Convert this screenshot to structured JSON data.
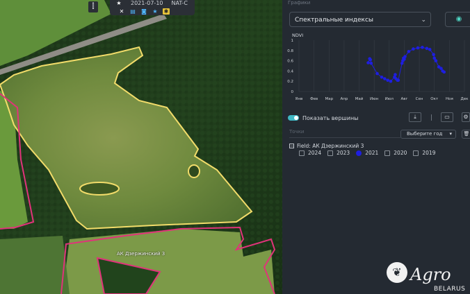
{
  "map": {
    "toolbar": {
      "date": "2021-07-10",
      "source": "NAT-C"
    },
    "field_label": "АК Дзержинский 3"
  },
  "panel": {
    "section_title": "Графики",
    "index_select": {
      "value": "Спектральные индексы"
    },
    "chart_data": {
      "type": "scatter",
      "title": "",
      "ylabel": "NDVI",
      "xlabel": "",
      "x_ticks": [
        "Янв",
        "Фев",
        "Мар",
        "Апр",
        "Май",
        "Июн",
        "Июл",
        "Авг",
        "Сен",
        "Окт",
        "Ноя",
        "Дек"
      ],
      "y_ticks": [
        "1",
        "0.8",
        "0.6",
        "0.4",
        "0.2",
        "0"
      ],
      "ylim": [
        0,
        1
      ],
      "grid": true,
      "series": [
        {
          "color": "#1e1ee0",
          "points": [
            [
              4.6,
              0.56
            ],
            [
              4.7,
              0.64
            ],
            [
              4.75,
              0.62
            ],
            [
              4.8,
              0.55
            ],
            [
              5.2,
              0.35
            ],
            [
              5.5,
              0.28
            ],
            [
              5.7,
              0.25
            ],
            [
              5.9,
              0.22
            ],
            [
              6.1,
              0.2
            ],
            [
              6.35,
              0.28
            ],
            [
              6.4,
              0.33
            ],
            [
              6.45,
              0.25
            ],
            [
              6.55,
              0.22
            ],
            [
              6.6,
              0.22
            ],
            [
              6.85,
              0.55
            ],
            [
              6.9,
              0.6
            ],
            [
              6.95,
              0.65
            ],
            [
              7.0,
              0.63
            ],
            [
              7.05,
              0.68
            ],
            [
              7.3,
              0.78
            ],
            [
              7.6,
              0.83
            ],
            [
              7.9,
              0.85
            ],
            [
              8.2,
              0.86
            ],
            [
              8.5,
              0.84
            ],
            [
              8.7,
              0.82
            ],
            [
              8.95,
              0.72
            ],
            [
              9.0,
              0.65
            ],
            [
              9.1,
              0.6
            ],
            [
              9.3,
              0.48
            ],
            [
              9.45,
              0.45
            ],
            [
              9.55,
              0.4
            ],
            [
              9.65,
              0.38
            ]
          ]
        }
      ]
    },
    "show_peaks_label": "Показать вершины",
    "points_placeholder": "Точки",
    "year_select": {
      "value": "Выберите год"
    },
    "field": {
      "label": "Field: АК Дзержинский 3",
      "years": [
        {
          "label": "2024",
          "checked": false
        },
        {
          "label": "2023",
          "checked": false
        },
        {
          "label": "2021",
          "checked": true
        },
        {
          "label": "2020",
          "checked": false
        },
        {
          "label": "2019",
          "checked": false
        }
      ]
    }
  },
  "logo": {
    "text": "Agro",
    "sub": "BELARUS"
  },
  "colors": {
    "accent": "#3fb8c4",
    "series": "#1e1ee0",
    "field_outline": "#f2dc6a",
    "neighbor_outline": "#e0337a"
  }
}
